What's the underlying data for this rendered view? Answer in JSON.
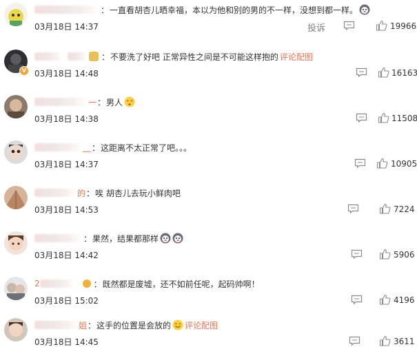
{
  "report_label": "投诉",
  "image_link_label": "评论配图",
  "comments": [
    {
      "name": "",
      "text": "一直看胡杏儿晒幸福，本以为他和别的男的不一样，没想到都一样。",
      "time": "03月18日 14:37",
      "likes": "19966",
      "has_report": true,
      "has_image_link": false
    },
    {
      "name": "",
      "text": "不要洗了好吧 正常异性之间是不可能这样抱的",
      "time": "03月18日 14:48",
      "likes": "16163",
      "has_report": false,
      "has_image_link": true
    },
    {
      "name": "一",
      "text": "男人",
      "time": "03月18日 14:38",
      "likes": "11508",
      "has_report": false,
      "has_image_link": false
    },
    {
      "name": "__",
      "text": "这距离不太正常了吧。。。",
      "time": "03月18日 14:37",
      "likes": "10905",
      "has_report": false,
      "has_image_link": false
    },
    {
      "name": "的",
      "text": "唉 胡杏儿去玩小鲜肉吧",
      "time": "03月18日 14:53",
      "likes": "7224",
      "has_report": false,
      "has_image_link": false
    },
    {
      "name": "",
      "text": "果然，结果都那样",
      "time": "03月18日 14:42",
      "likes": "5906",
      "has_report": false,
      "has_image_link": false
    },
    {
      "name": "2",
      "text": "既然都是废墟，还不如前任呢，起码帅啊！",
      "time": "03月18日 15:02",
      "likes": "4196",
      "has_report": false,
      "has_image_link": false
    },
    {
      "name": "姐",
      "text": "这手的位置是会放的",
      "time": "03月18日 14:45",
      "likes": "3611",
      "has_report": false,
      "has_image_link": true
    }
  ],
  "colors": {
    "link": "#eb7350",
    "text": "#333333",
    "muted": "#808080"
  },
  "icons": {
    "comment": "comment-bubble-icon",
    "like": "thumbs-up-icon"
  }
}
